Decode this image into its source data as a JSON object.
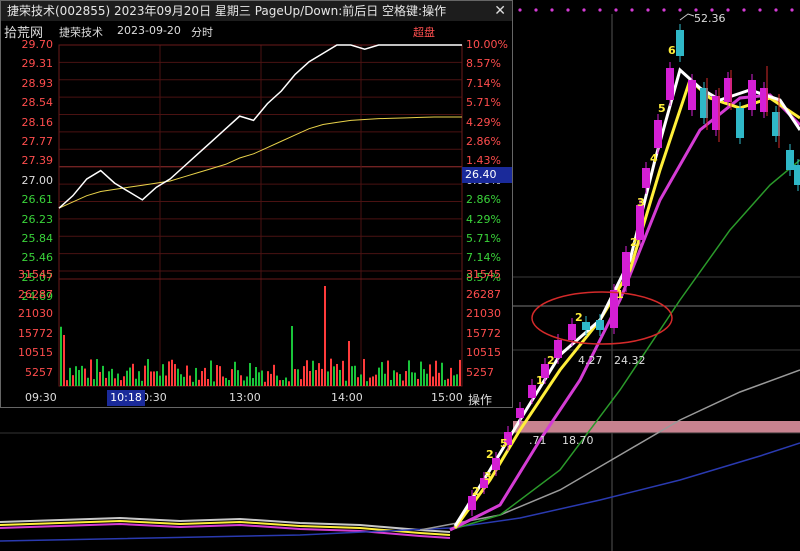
{
  "window": {
    "title": "捷荣技术(002855) 2023年09月20日 星期三 PageUp/Down:前后日 空格键:操作",
    "close_glyph": "✕",
    "watermark": "拾荒网"
  },
  "intraday": {
    "name": "捷荣技术",
    "date": "2023-09-20",
    "mode": "分时",
    "badge": "超盘",
    "current_price": "26.40",
    "hover_time": "10:18",
    "operate_button": "操作",
    "price_ticks": [
      "29.70",
      "29.31",
      "28.93",
      "28.54",
      "28.16",
      "27.77",
      "27.39",
      "27.00",
      "26.61",
      "26.23",
      "25.84",
      "25.46",
      "25.07",
      "24.69"
    ],
    "pct_ticks": [
      "10.00%",
      "8.57%",
      "7.14%",
      "5.71%",
      "4.29%",
      "2.86%",
      "1.43%",
      "0.00%",
      "2.86%",
      "4.29%",
      "5.71%",
      "7.14%",
      "8.57%"
    ],
    "volume_ticks": [
      "31545",
      "26287",
      "21030",
      "15772",
      "10515",
      "5257"
    ],
    "time_ticks": [
      "09:30",
      "10:30",
      "13:00",
      "14:00",
      "15:00"
    ]
  },
  "kline": {
    "high_label": "52.36",
    "annotations": [
      {
        "text": "24.32"
      },
      {
        "text": "4.27"
      },
      {
        "text": "18.70"
      },
      {
        "text": ".71"
      }
    ],
    "step_numbers": [
      "2",
      "2",
      "1",
      "1",
      "2",
      "5",
      "2",
      "3",
      "2",
      "3",
      "4",
      "5",
      "6"
    ]
  },
  "chart_data": {
    "type": "line",
    "title": "",
    "xlabel": "",
    "ylabel": "",
    "ylim": [
      24.3,
      29.7
    ],
    "x": [
      "09:30",
      "15:00"
    ],
    "series": [
      {
        "values": [
          25.8,
          26.1,
          26.5,
          26.7,
          26.4,
          26.2,
          26.0,
          26.3,
          26.5,
          26.8,
          27.1,
          27.4,
          27.7,
          28.0,
          27.9,
          28.3,
          28.6,
          29.0,
          29.3,
          29.5,
          29.7,
          29.7,
          29.6,
          29.7,
          29.7,
          29.7,
          29.7,
          29.7,
          29.7,
          29.7
        ]
      },
      {
        "values": [
          25.8,
          25.95,
          26.1,
          26.2,
          26.25,
          26.3,
          26.35,
          26.4,
          26.45,
          26.55,
          26.65,
          26.75,
          26.85,
          27.0,
          27.1,
          27.25,
          27.4,
          27.55,
          27.7,
          27.8,
          27.85,
          27.9,
          27.92,
          27.94,
          27.95,
          27.96,
          27.97,
          27.98,
          27.98,
          27.98
        ]
      }
    ]
  },
  "colors": {
    "up": "#ff3b3b",
    "down": "#19c43a",
    "price_line": "#ffffff",
    "avg_line": "#e8d24a",
    "ma_white": "#ffffff",
    "ma_yellow": "#ffef3a",
    "ma_magenta": "#d43cd4",
    "ma_green": "#2a9a2a",
    "ma_gray": "#9a9a9a",
    "ma_blue": "#2a3ab0",
    "ring": "#d42a2a",
    "pink_band": "#c8828f",
    "dots": "#d43cd4"
  }
}
